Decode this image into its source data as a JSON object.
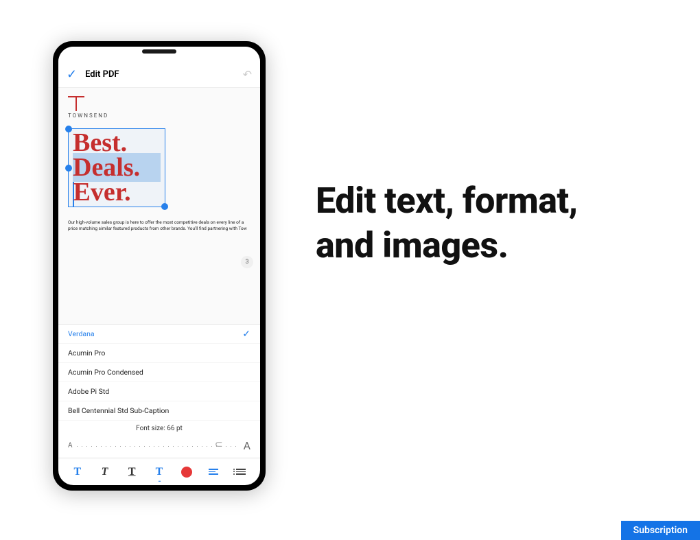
{
  "header": {
    "title": "Edit PDF"
  },
  "document": {
    "brand": "TOWNSEND",
    "headline_line1": "Best.",
    "headline_line2": "Deals.",
    "headline_line3": "Ever.",
    "corner_count": "3",
    "body": "Our high-volume sales group is here to offer the most competitive deals on every line of a price matching similar featured products from other brands. You'll find partnering with Tow"
  },
  "font_panel": {
    "fonts": [
      {
        "name": "Verdana",
        "selected": true
      },
      {
        "name": "Acumin Pro",
        "selected": false
      },
      {
        "name": "Acumin Pro Condensed",
        "selected": false
      },
      {
        "name": "Adobe Pi Std",
        "selected": false
      },
      {
        "name": "Bell Centennial Std Sub-Caption",
        "selected": false
      }
    ],
    "size_label": "Font size: 66 pt"
  },
  "tagline": "Edit text, format, and images.",
  "subscription_label": "Subscription"
}
